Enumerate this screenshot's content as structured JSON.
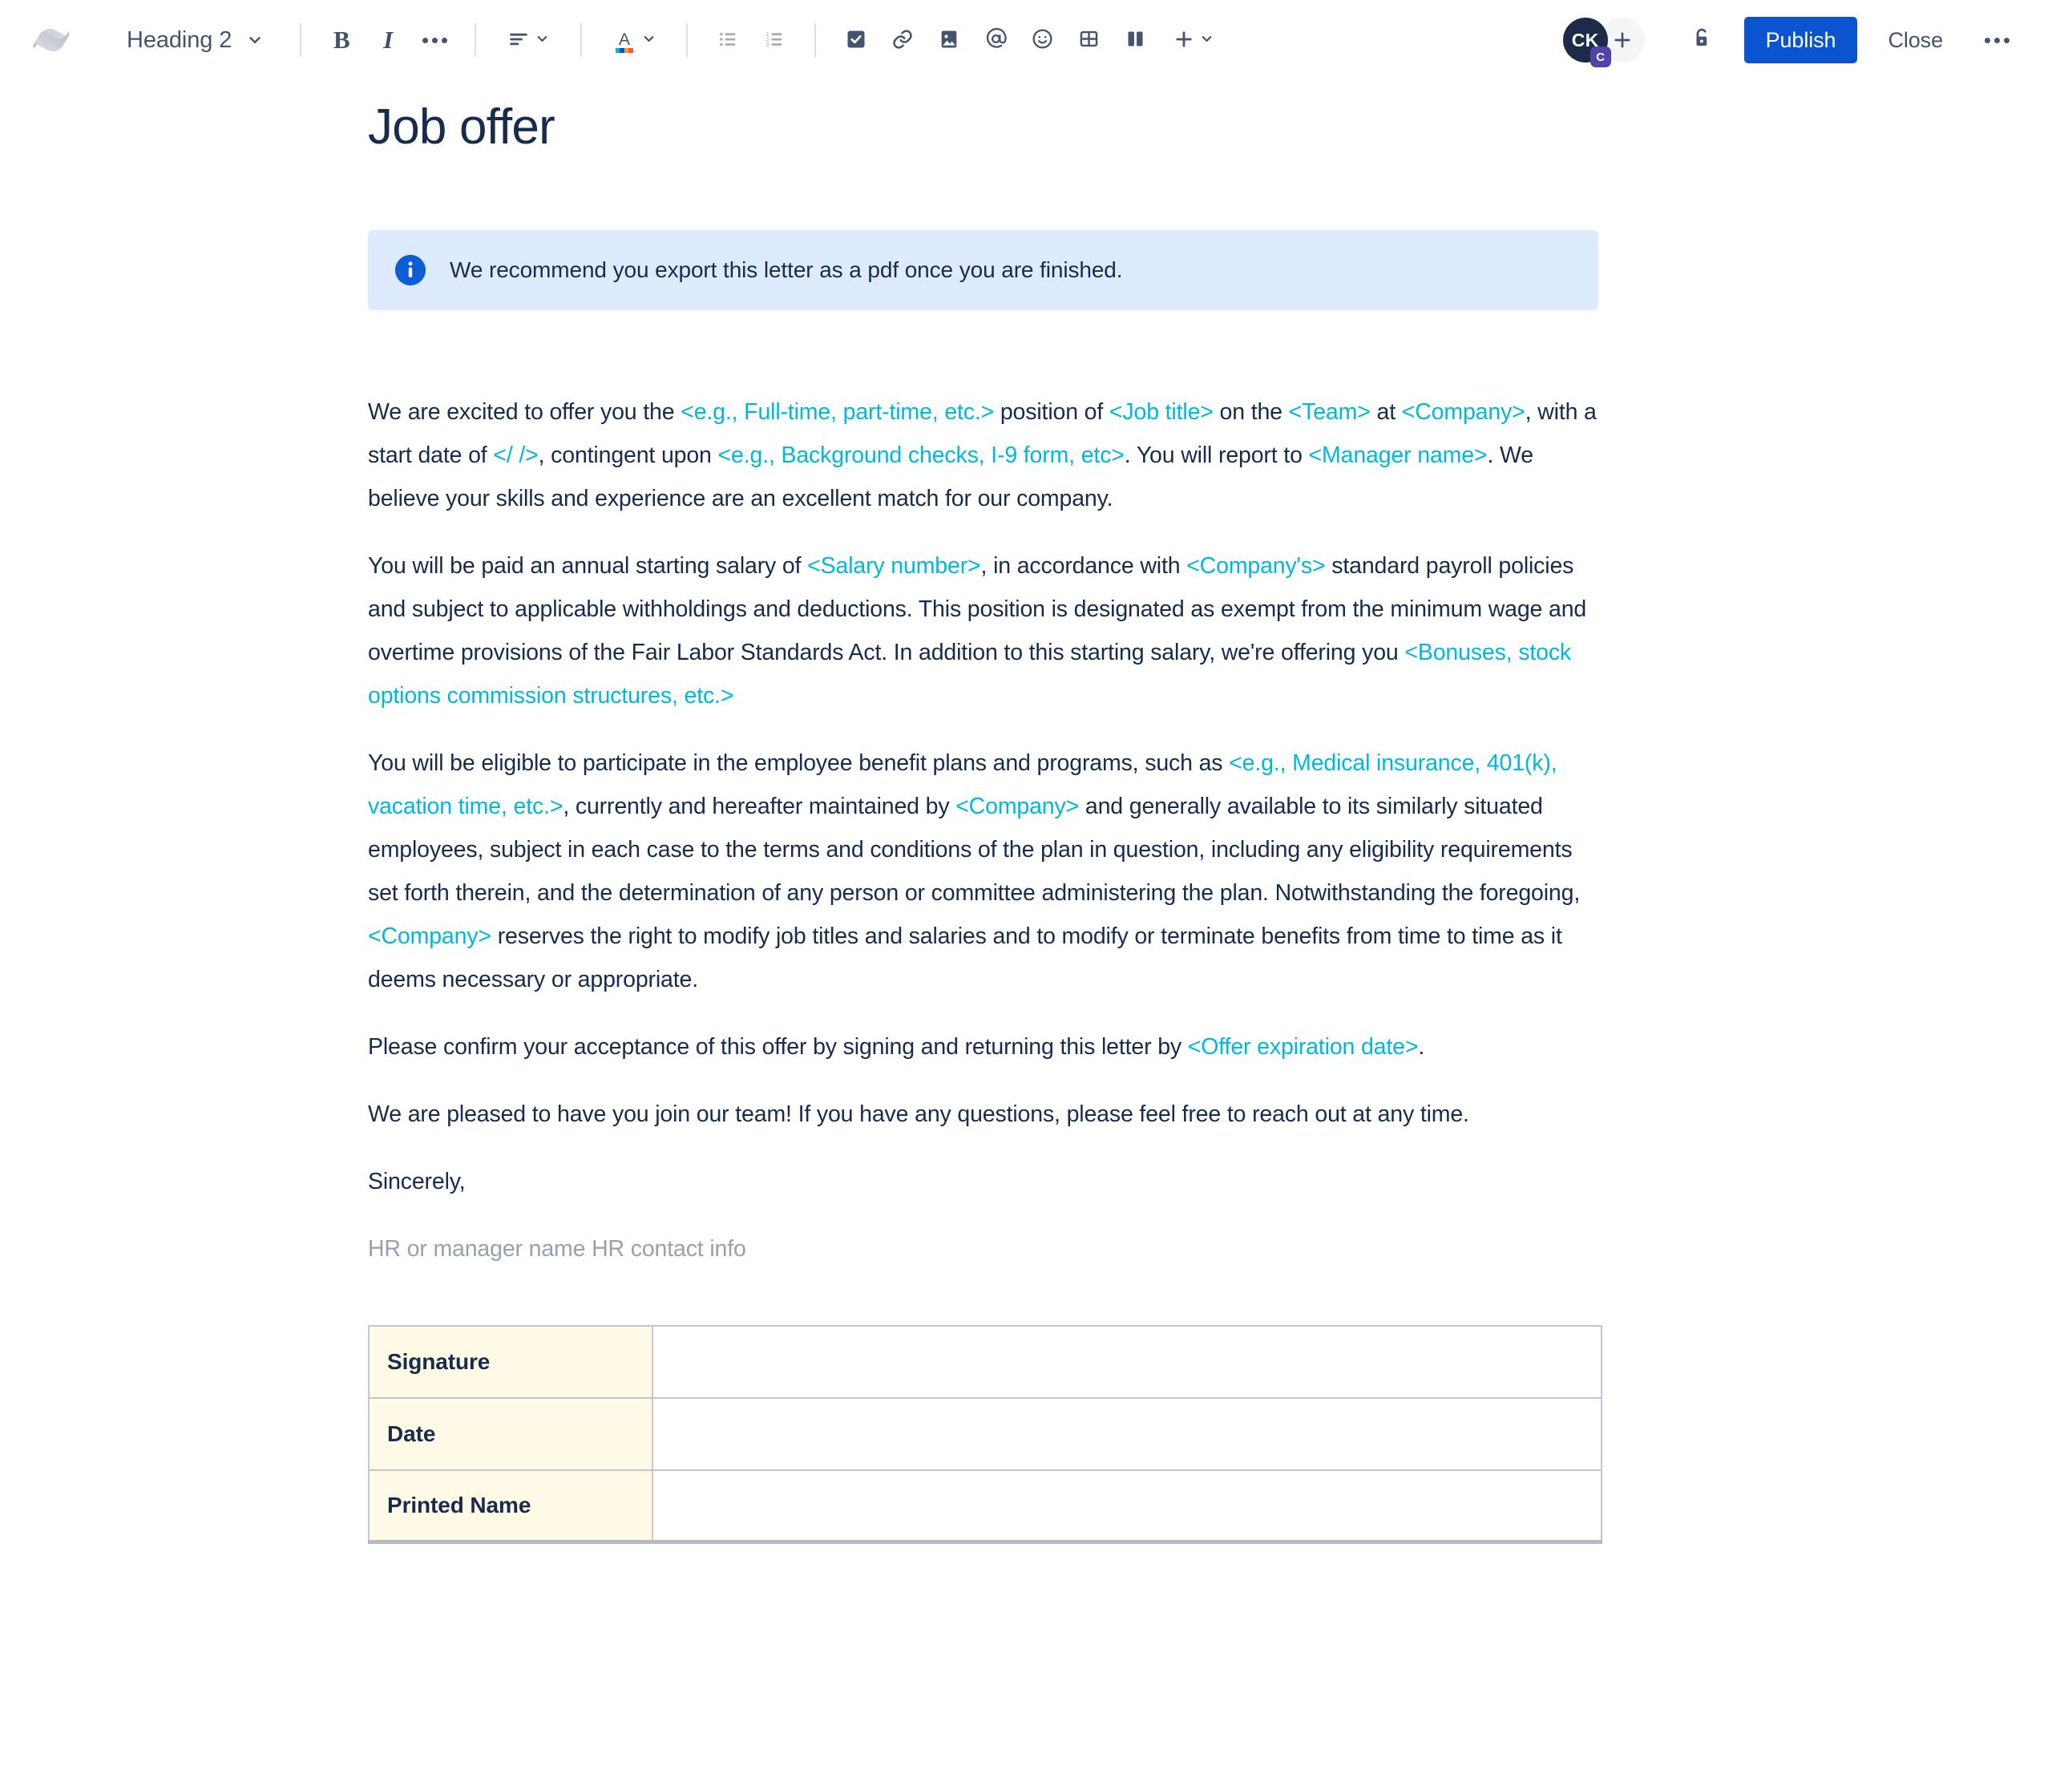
{
  "app": {
    "name": "Confluence",
    "logo_icon": "confluence-logo-icon"
  },
  "toolbar": {
    "block_style": {
      "label": "Heading 2",
      "chevron_icon": "chevron-down-icon"
    },
    "bold_label": "B",
    "italic_label": "I",
    "more_formatting_icon": "ellipsis-icon",
    "align_icon": "text-align-left-icon",
    "align_chevron_icon": "chevron-down-icon",
    "text_color_label": "A",
    "text_color_chevron_icon": "chevron-down-icon",
    "bullet_list_icon": "bullet-list-icon",
    "numbered_list_icon": "numbered-list-icon",
    "task_icon": "checkbox-checked-icon",
    "link_icon": "link-icon",
    "image_icon": "image-icon",
    "mention_icon": "mention-at-icon",
    "emoji_icon": "emoji-smiley-icon",
    "table_icon": "table-grid-icon",
    "layout_icon": "two-column-layout-icon",
    "insert_icon": "plus-icon",
    "insert_chevron_icon": "chevron-down-icon",
    "avatar": {
      "initials": "CK",
      "badge": "C",
      "name": "avatar"
    },
    "add_collaborator_icon": "plus-icon",
    "restrictions_icon": "unlocked-padlock-icon",
    "publish_label": "Publish",
    "close_label": "Close",
    "overflow_icon": "ellipsis-icon"
  },
  "document": {
    "title": "Job offer",
    "info_panel": {
      "icon": "info-circle-icon",
      "text": "We recommend you export this letter as a pdf once you are finished."
    },
    "paragraphs": {
      "p1": {
        "s1": "We are excited to offer you the ",
        "ph1": "<e.g., Full-time, part-time, etc.>",
        "s2": " position of ",
        "ph2": "<Job title>",
        "s3": " on the ",
        "ph3": "<Team>",
        "s4": " at ",
        "ph4": "<Company>",
        "s5": ", with a start date of ",
        "ph5": "</ />",
        "s6": ", contingent upon ",
        "ph6": "<e.g., Background checks, I-9 form, etc>",
        "s7": ". You will report to ",
        "ph7": "<Manager name>",
        "s8": ". We believe your skills and experience are an excellent match for our company."
      },
      "p2": {
        "s1": "You will be paid an annual starting salary of ",
        "ph1": "<Salary number>",
        "s2": ", in accordance with ",
        "ph2": "<Company's>",
        "s3": " standard payroll policies and subject to applicable withholdings and deductions. This position is designated as exempt from the minimum wage and overtime provisions of the Fair Labor Standards Act. In addition to this starting salary, we're offering you ",
        "ph3": "<Bonuses, stock options commission structures, etc.>"
      },
      "p3": {
        "s1": "You will be eligible to participate in the employee benefit plans and programs, such as ",
        "ph1": "<e.g., Medical insurance, 401(k), vacation time, etc.>",
        "s2": ", currently and hereafter maintained by ",
        "ph2": "<Company>",
        "s3": " and generally available to its similarly situated employees, subject in each case to the terms and conditions of the plan in question, including any eligibility requirements set forth therein, and the determination of any person or committee administering the plan. Notwithstanding the foregoing, ",
        "ph3": "<Company>",
        "s4": " reserves the right to modify job titles and salaries and to modify or terminate benefits from time to time as it deems necessary or appropriate."
      },
      "p4": {
        "s1": "Please confirm your acceptance of this offer by signing and returning this letter by ",
        "ph1": "<Offer expiration date>",
        "s2": "."
      },
      "p5": {
        "s1": "We are pleased to have you join our team! If you have any questions, please feel free to reach out at any time."
      },
      "p6": {
        "s1": "Sincerely,"
      }
    },
    "signer_placeholder": "HR or manager name HR contact info",
    "signature_table": {
      "rows": [
        {
          "label": "Signature",
          "value": ""
        },
        {
          "label": "Date",
          "value": ""
        },
        {
          "label": "Printed Name",
          "value": ""
        }
      ]
    }
  },
  "colors": {
    "placeholder_text": "#00B8D9",
    "primary_button": "#0B54CF",
    "info_panel_bg": "#DEEBFF",
    "table_header_bg": "#FFFAE6",
    "body_text": "#172B4D",
    "avatar_bg": "#1D2B4A",
    "avatar_badge_bg": "#5243AA"
  }
}
